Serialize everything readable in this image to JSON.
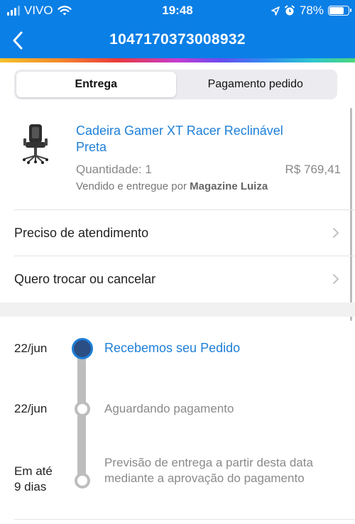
{
  "status_bar": {
    "carrier": "VIVO",
    "time": "19:48",
    "battery": "78%",
    "battery_level": 0.78
  },
  "header": {
    "title": "1047170373008932",
    "accent": "#0a7fe6"
  },
  "tabs": [
    {
      "label": "Entrega",
      "active": true
    },
    {
      "label": "Pagamento pedido",
      "active": false
    }
  ],
  "product": {
    "name": "Cadeira Gamer XT Racer Reclinável Preta",
    "quantity": "Quantidade: 1",
    "price": "R$ 769,41",
    "seller_prefix": "Vendido e entregue por",
    "seller": "Magazine Luiza"
  },
  "actions": [
    {
      "label": "Preciso de atendimento"
    },
    {
      "label": "Quero trocar ou cancelar"
    }
  ],
  "timeline": [
    {
      "date": "22/jun",
      "text": "Recebemos seu Pedido",
      "active": true
    },
    {
      "date": "22/jun",
      "text": "Aguardando pagamento",
      "active": false
    },
    {
      "date": "Em até\n9 dias",
      "text": "Previsão de entrega a partir desta data mediante a aprovação do pagamento",
      "active": false
    }
  ],
  "colors": {
    "link_blue": "#1e7fd8",
    "timeline_active_dot": "#2b4e84",
    "timeline_grey": "#bdbdbd"
  }
}
